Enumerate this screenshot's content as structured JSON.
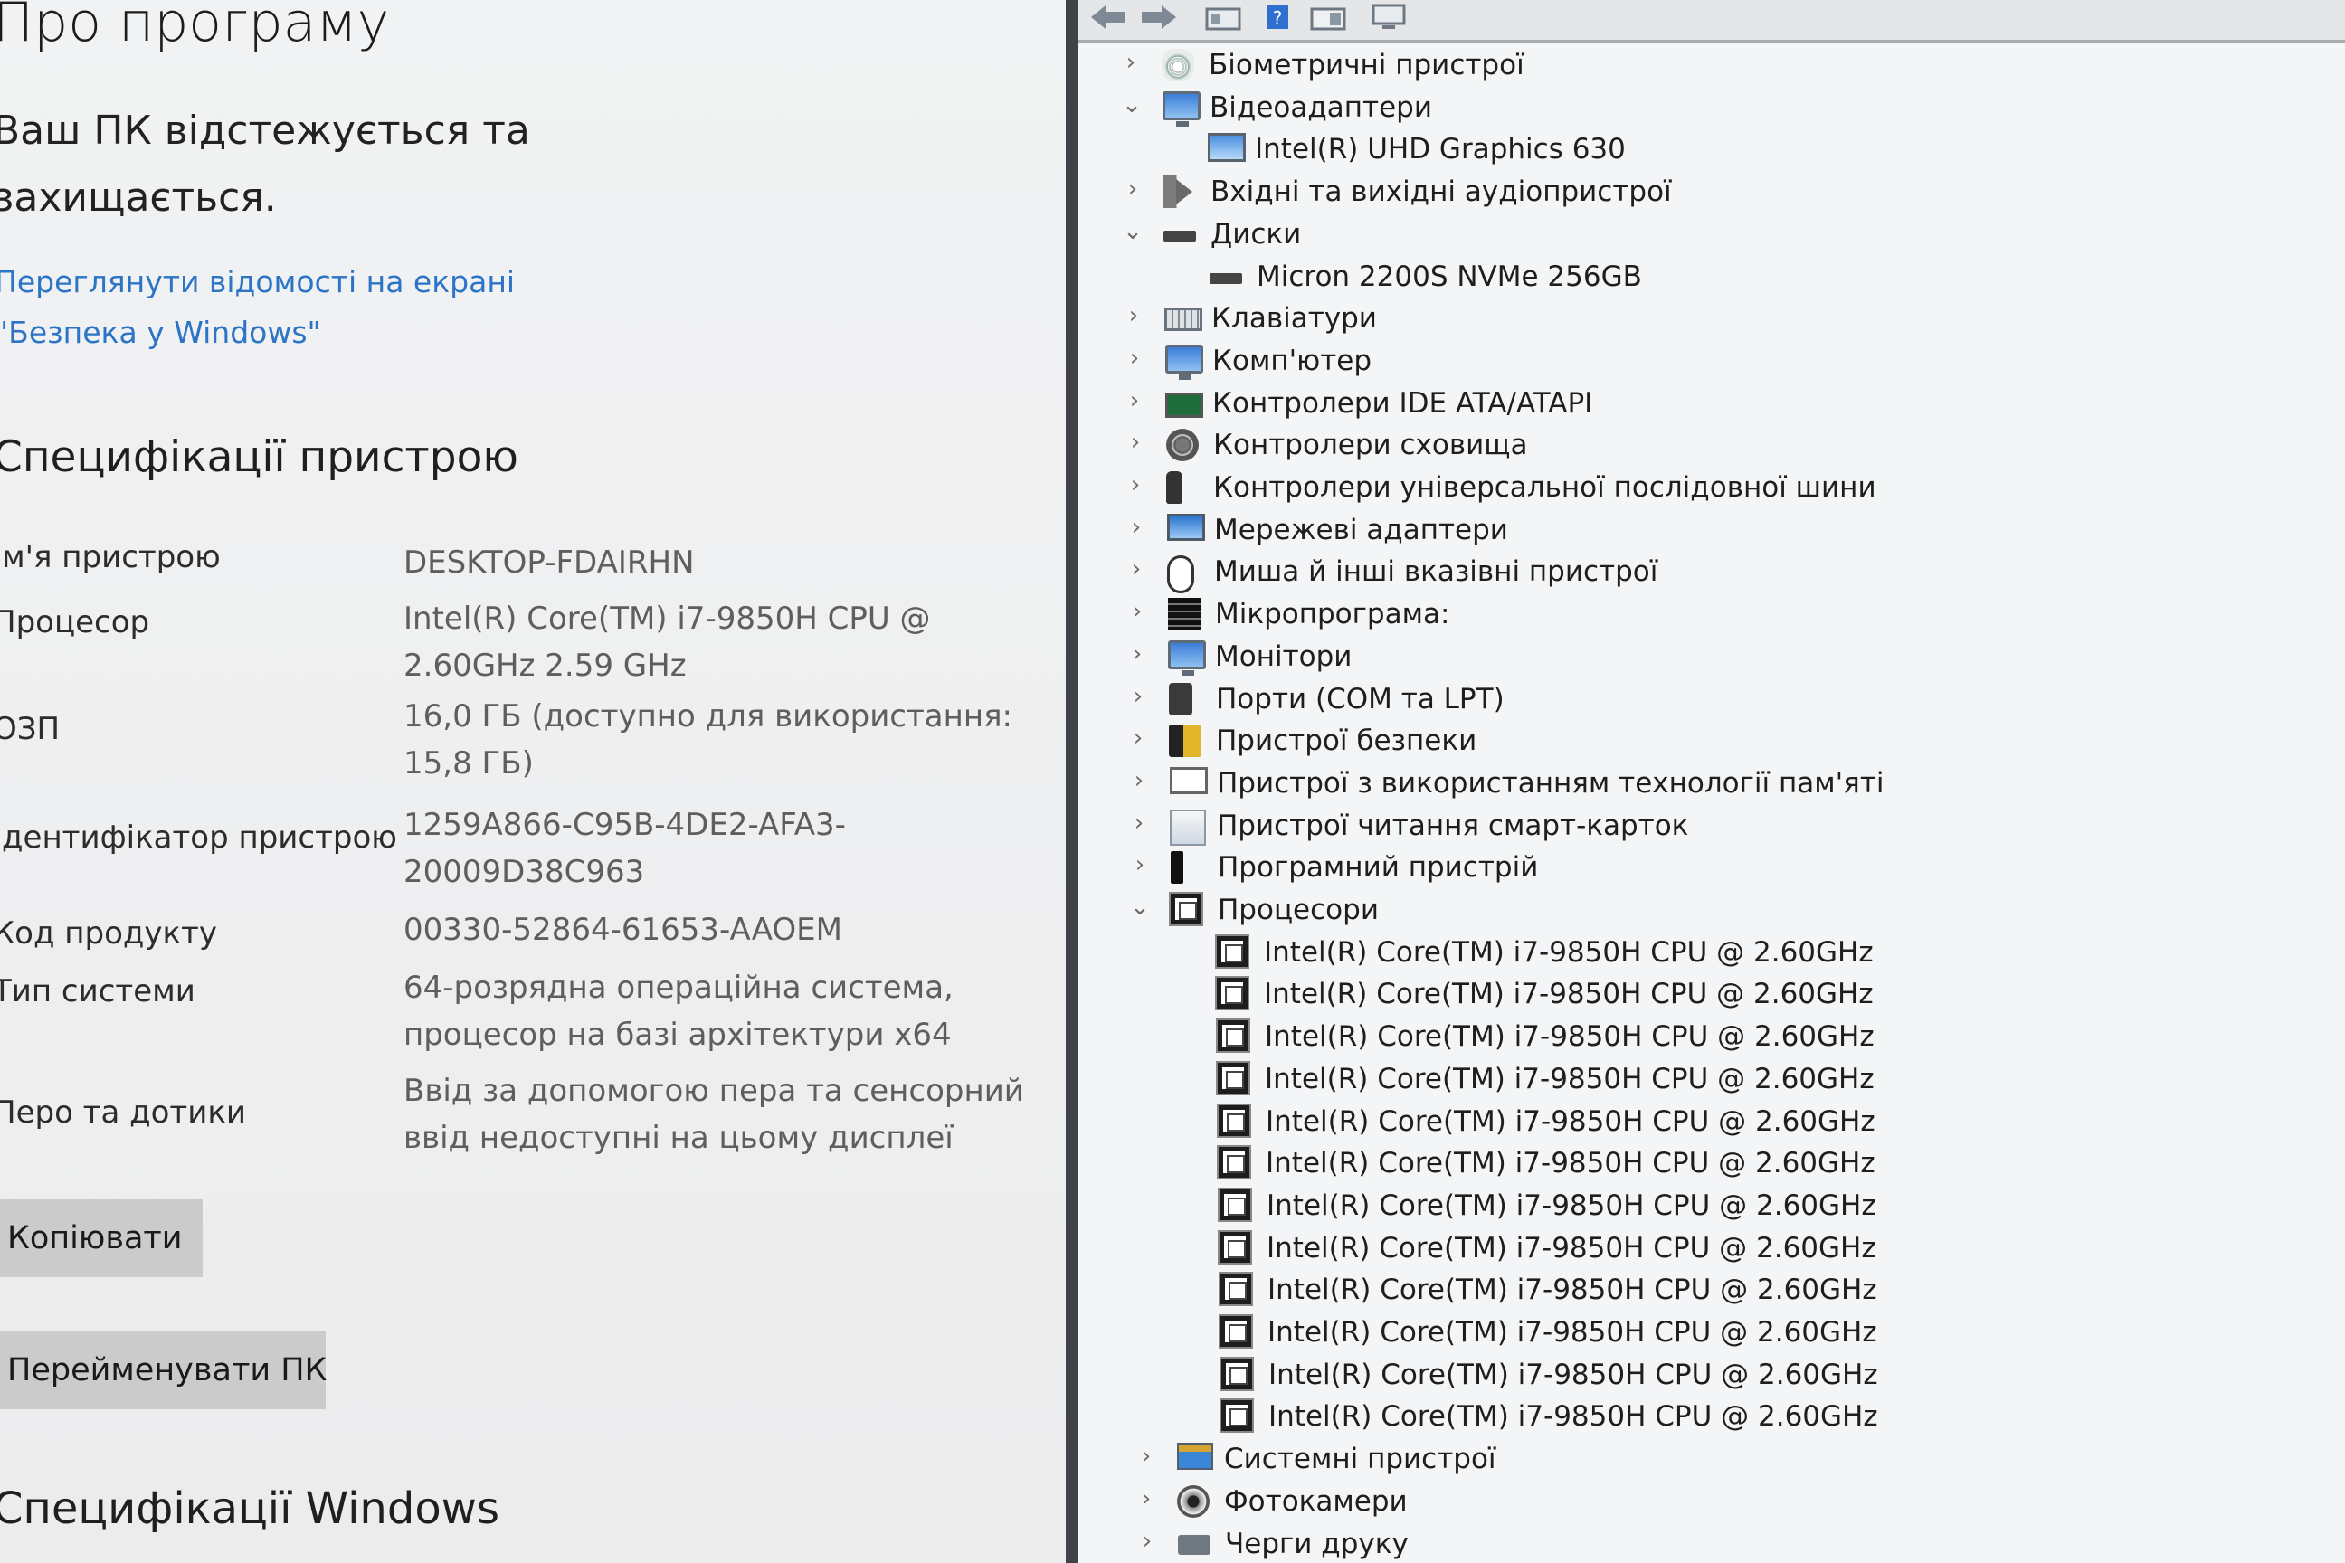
{
  "about": {
    "title": "Про програму",
    "status_text": "Ваш ПК відстежується та захищається.",
    "security_link": "Переглянути відомості на екрані \"Безпека у Windows\"",
    "specs_title": "Специфікації пристрою",
    "specs": [
      {
        "label": "Ім'я пристрою",
        "value": "DESKTOP-FDAIRHN"
      },
      {
        "label": "Процесор",
        "value": "Intel(R) Core(TM) i7-9850H CPU @ 2.60GHz   2.59 GHz"
      },
      {
        "label": "ОЗП",
        "value": "16,0 ГБ (доступно для використання: 15,8 ГБ)"
      },
      {
        "label": "Ідентифікатор пристрою",
        "value": "1259A866-C95B-4DE2-AFA3-20009D38C963"
      },
      {
        "label": "Код продукту",
        "value": "00330-52864-61653-AAOEM"
      },
      {
        "label": "Тип системи",
        "value": "64-розрядна операційна система, процесор на базі архітектури x64"
      },
      {
        "label": "Перо та дотики",
        "value": "Ввід за допомогою пера та сенсорний ввід недоступні на цьому дисплеї"
      }
    ],
    "copy_button": "Копіювати",
    "rename_button": "Перейменувати ПК",
    "windows_specs_title": "Специфікації Windows"
  },
  "device_manager": {
    "toolbar_icons": [
      "back-icon",
      "forward-icon",
      "properties-icon",
      "help-icon",
      "show-hidden-icon",
      "scan-icon"
    ],
    "tree": [
      {
        "label": "Біометричні пристрої",
        "icon": "bio",
        "expanded": false,
        "level": 0
      },
      {
        "label": "Відеоадаптери",
        "icon": "monitor",
        "expanded": true,
        "level": 0
      },
      {
        "label": "Intel(R) UHD Graphics 630",
        "icon": "gpu",
        "level": 1
      },
      {
        "label": "Вхідні та вихідні аудіопристрої",
        "icon": "audio",
        "expanded": false,
        "level": 0
      },
      {
        "label": "Диски",
        "icon": "disk",
        "expanded": true,
        "level": 0
      },
      {
        "label": "Micron 2200S NVMe 256GB",
        "icon": "disk",
        "level": 1
      },
      {
        "label": "Клавіатури",
        "icon": "kbd",
        "expanded": false,
        "level": 0
      },
      {
        "label": "Комп'ютер",
        "icon": "monitor",
        "expanded": false,
        "level": 0
      },
      {
        "label": "Контролери IDE ATA/ATAPI",
        "icon": "ide",
        "expanded": false,
        "level": 0
      },
      {
        "label": "Контролери сховища",
        "icon": "storage",
        "expanded": false,
        "level": 0
      },
      {
        "label": "Контролери універсальної послідовної шини",
        "icon": "usb",
        "expanded": false,
        "level": 0
      },
      {
        "label": "Мережеві адаптери",
        "icon": "net",
        "expanded": false,
        "level": 0
      },
      {
        "label": "Миша й інші вказівні пристрої",
        "icon": "mouse",
        "expanded": false,
        "level": 0
      },
      {
        "label": "Мікропрограма:",
        "icon": "firm",
        "expanded": false,
        "level": 0
      },
      {
        "label": "Монітори",
        "icon": "monitor",
        "expanded": false,
        "level": 0
      },
      {
        "label": "Порти (COM та LPT)",
        "icon": "port",
        "expanded": false,
        "level": 0
      },
      {
        "label": "Пристрої безпеки",
        "icon": "sec",
        "expanded": false,
        "level": 0
      },
      {
        "label": "Пристрої з використанням технології пам'яті",
        "icon": "mem",
        "expanded": false,
        "level": 0
      },
      {
        "label": "Пристрої читання смарт-карток",
        "icon": "smart",
        "expanded": false,
        "level": 0
      },
      {
        "label": "Програмний пристрій",
        "icon": "soft",
        "expanded": false,
        "level": 0
      },
      {
        "label": "Процесори",
        "icon": "cpu",
        "expanded": true,
        "level": 0
      },
      {
        "label": "Intel(R) Core(TM) i7-9850H CPU @ 2.60GHz",
        "icon": "cpu",
        "level": 1
      },
      {
        "label": "Intel(R) Core(TM) i7-9850H CPU @ 2.60GHz",
        "icon": "cpu",
        "level": 1
      },
      {
        "label": "Intel(R) Core(TM) i7-9850H CPU @ 2.60GHz",
        "icon": "cpu",
        "level": 1
      },
      {
        "label": "Intel(R) Core(TM) i7-9850H CPU @ 2.60GHz",
        "icon": "cpu",
        "level": 1
      },
      {
        "label": "Intel(R) Core(TM) i7-9850H CPU @ 2.60GHz",
        "icon": "cpu",
        "level": 1
      },
      {
        "label": "Intel(R) Core(TM) i7-9850H CPU @ 2.60GHz",
        "icon": "cpu",
        "level": 1
      },
      {
        "label": "Intel(R) Core(TM) i7-9850H CPU @ 2.60GHz",
        "icon": "cpu",
        "level": 1
      },
      {
        "label": "Intel(R) Core(TM) i7-9850H CPU @ 2.60GHz",
        "icon": "cpu",
        "level": 1
      },
      {
        "label": "Intel(R) Core(TM) i7-9850H CPU @ 2.60GHz",
        "icon": "cpu",
        "level": 1
      },
      {
        "label": "Intel(R) Core(TM) i7-9850H CPU @ 2.60GHz",
        "icon": "cpu",
        "level": 1
      },
      {
        "label": "Intel(R) Core(TM) i7-9850H CPU @ 2.60GHz",
        "icon": "cpu",
        "level": 1
      },
      {
        "label": "Intel(R) Core(TM) i7-9850H CPU @ 2.60GHz",
        "icon": "cpu",
        "level": 1
      },
      {
        "label": "Системні пристрої",
        "icon": "sys",
        "expanded": false,
        "level": 0
      },
      {
        "label": "Фотокамери",
        "icon": "cam",
        "expanded": false,
        "level": 0
      },
      {
        "label": "Черги друку",
        "icon": "print",
        "expanded": false,
        "level": 0
      }
    ]
  },
  "colors": {
    "link": "#2b74c6",
    "button": "#cbcbcb",
    "divider": "#3f4246"
  }
}
